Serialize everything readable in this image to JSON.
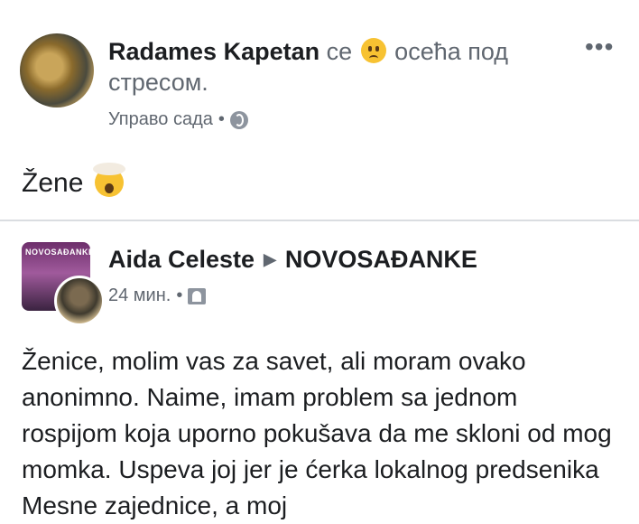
{
  "post1": {
    "author": "Radames Kapetan",
    "feeling_prefix": "се",
    "feeling_emoji": "worried-face-icon",
    "feeling_text": "осећа под стресом.",
    "timestamp": "Управо сада",
    "separator": "•",
    "privacy_icon": "globe-icon",
    "more": "•••",
    "text": "Žene",
    "text_emoji": "exploding-head-icon"
  },
  "post2": {
    "author": "Aida Celeste",
    "arrow": "▶",
    "group": "NOVOSAĐANKE",
    "group_thumb_text": "NOVOSAĐANKE",
    "timestamp": "24 мин.",
    "separator": "•",
    "privacy_icon": "group-members-icon",
    "body": "Ženice, molim vas za savet, ali moram ovako anonimno. Naime, imam problem sa jednom rospijom koja uporno pokušava da me skloni od mog momka. Uspeva joj jer je ćerka lokalnog predsenika Mesne zajednice, a moj"
  },
  "colors": {
    "text": "#1c1e21",
    "secondary": "#606770",
    "divider": "#dadde1"
  }
}
